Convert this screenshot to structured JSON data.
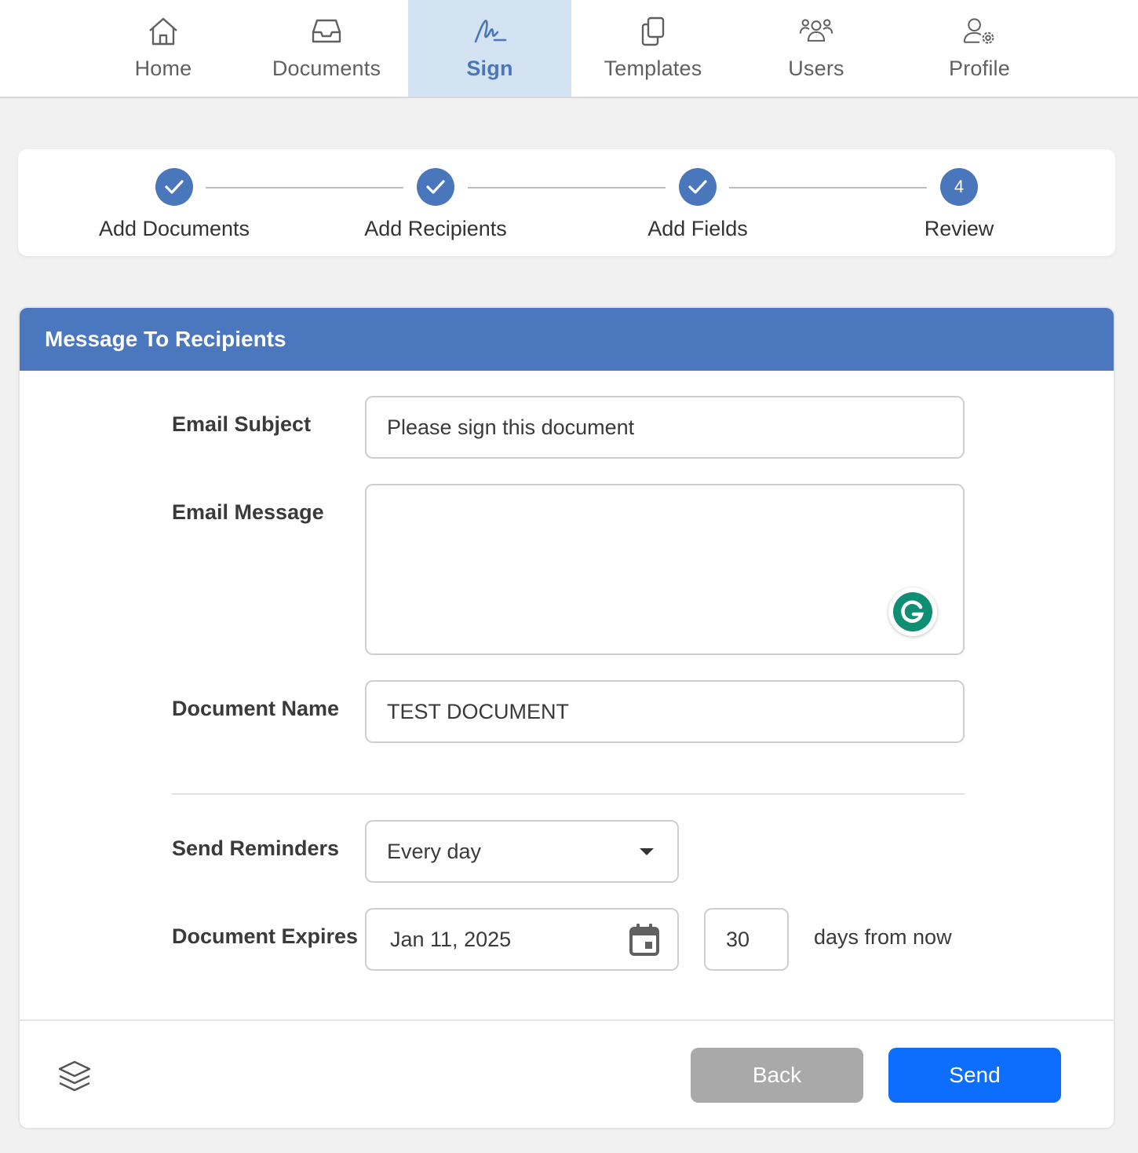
{
  "nav": {
    "items": [
      {
        "label": "Home",
        "icon": "home-icon"
      },
      {
        "label": "Documents",
        "icon": "inbox-icon"
      },
      {
        "label": "Sign",
        "icon": "signature-icon"
      },
      {
        "label": "Templates",
        "icon": "copy-icon"
      },
      {
        "label": "Users",
        "icon": "users-icon"
      },
      {
        "label": "Profile",
        "icon": "user-settings-icon"
      }
    ],
    "active": "Sign"
  },
  "stepper": {
    "steps": [
      {
        "label": "Add Documents",
        "state": "complete"
      },
      {
        "label": "Add Recipients",
        "state": "complete"
      },
      {
        "label": "Add Fields",
        "state": "complete"
      },
      {
        "label": "Review",
        "state": "current",
        "number": "4"
      }
    ]
  },
  "form": {
    "title": "Message To Recipients",
    "email_subject_label": "Email Subject",
    "email_subject_value": "Please sign this document",
    "email_message_label": "Email Message",
    "email_message_value": "",
    "document_name_label": "Document Name",
    "document_name_value": "TEST DOCUMENT",
    "send_reminders_label": "Send Reminders",
    "send_reminders_value": "Every day",
    "document_expires_label": "Document Expires",
    "expire_date": "Jan 11, 2025",
    "expire_days": "30",
    "days_suffix": "days from now"
  },
  "actions": {
    "back_label": "Back",
    "send_label": "Send"
  },
  "colors": {
    "accent": "#4a77bd",
    "active_nav_bg": "#d3e3f1",
    "send_button": "#0d6efd",
    "back_button": "#a9a9a9",
    "grammarly": "#0e8f73"
  }
}
